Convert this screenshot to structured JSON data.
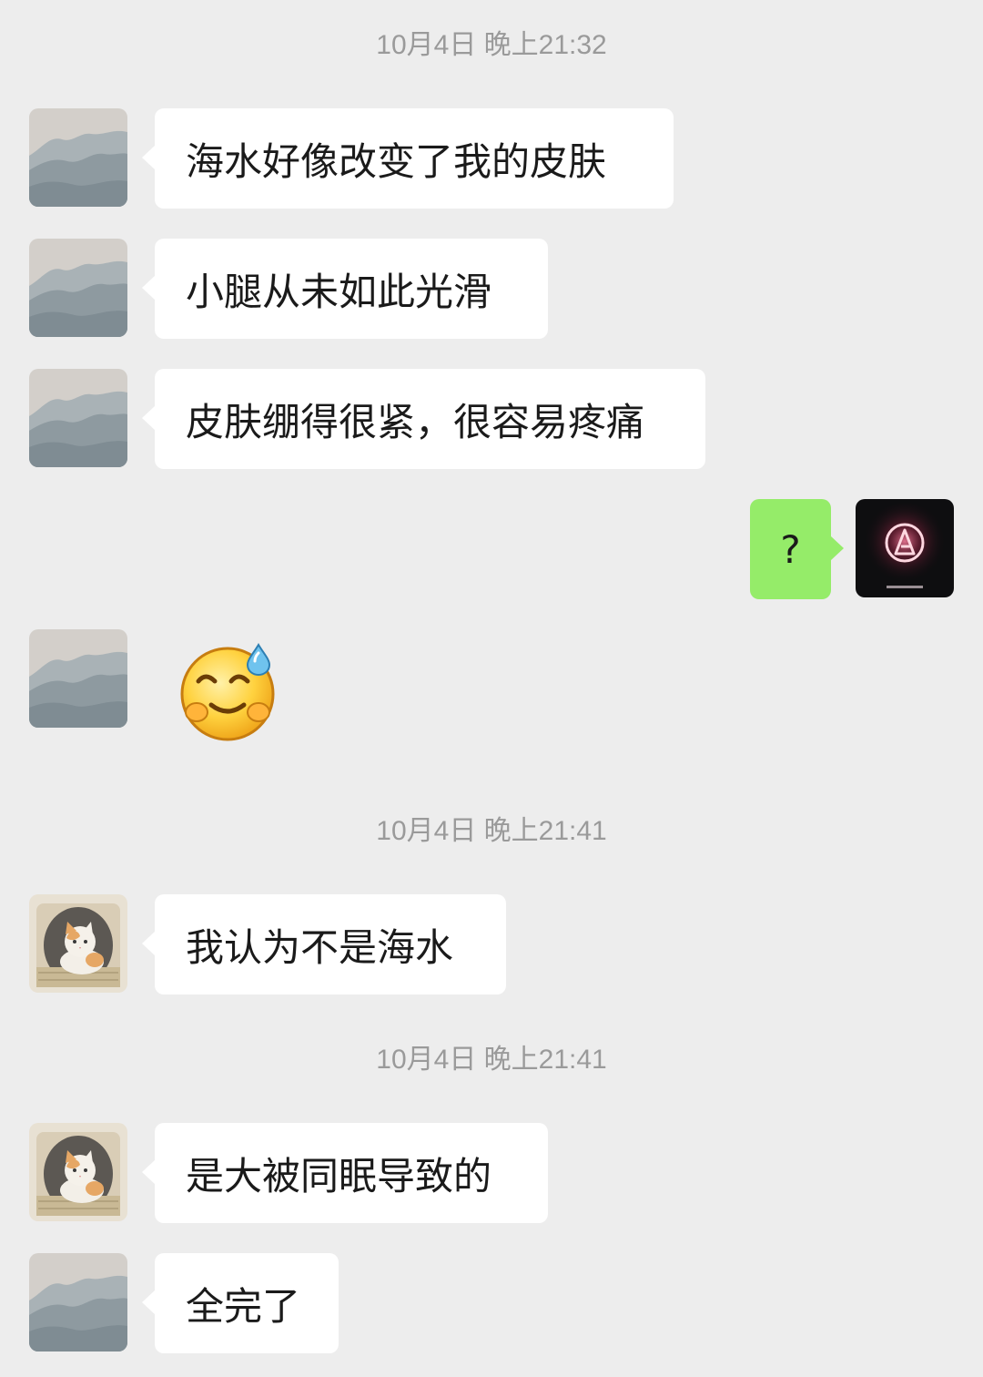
{
  "colors": {
    "background": "#ededed",
    "incoming_bubble": "#ffffff",
    "outgoing_bubble": "#95ec69",
    "timestamp": "#9a9a9a"
  },
  "timestamps": [
    "10月4日 晚上21:32",
    "10月4日 晚上21:41",
    "10月4日 晚上21:41"
  ],
  "messages": [
    {
      "direction": "incoming",
      "avatar": "mountain-avatar",
      "text": "海水好像改变了我的皮肤"
    },
    {
      "direction": "incoming",
      "avatar": "mountain-avatar",
      "text": "小腿从未如此光滑"
    },
    {
      "direction": "incoming",
      "avatar": "mountain-avatar",
      "text": "皮肤绷得很紧，很容易疼痛"
    },
    {
      "direction": "outgoing",
      "avatar": "glowing-logo-avatar",
      "text": "?"
    },
    {
      "direction": "incoming",
      "avatar": "mountain-avatar",
      "sticker": "sweat-smile-emoji"
    },
    {
      "direction": "incoming",
      "avatar": "cat-avatar",
      "text": "我认为不是海水"
    },
    {
      "direction": "incoming",
      "avatar": "cat-avatar",
      "text": "是大被同眠导致的"
    },
    {
      "direction": "incoming",
      "avatar": "mountain-avatar",
      "text": "全完了"
    }
  ]
}
